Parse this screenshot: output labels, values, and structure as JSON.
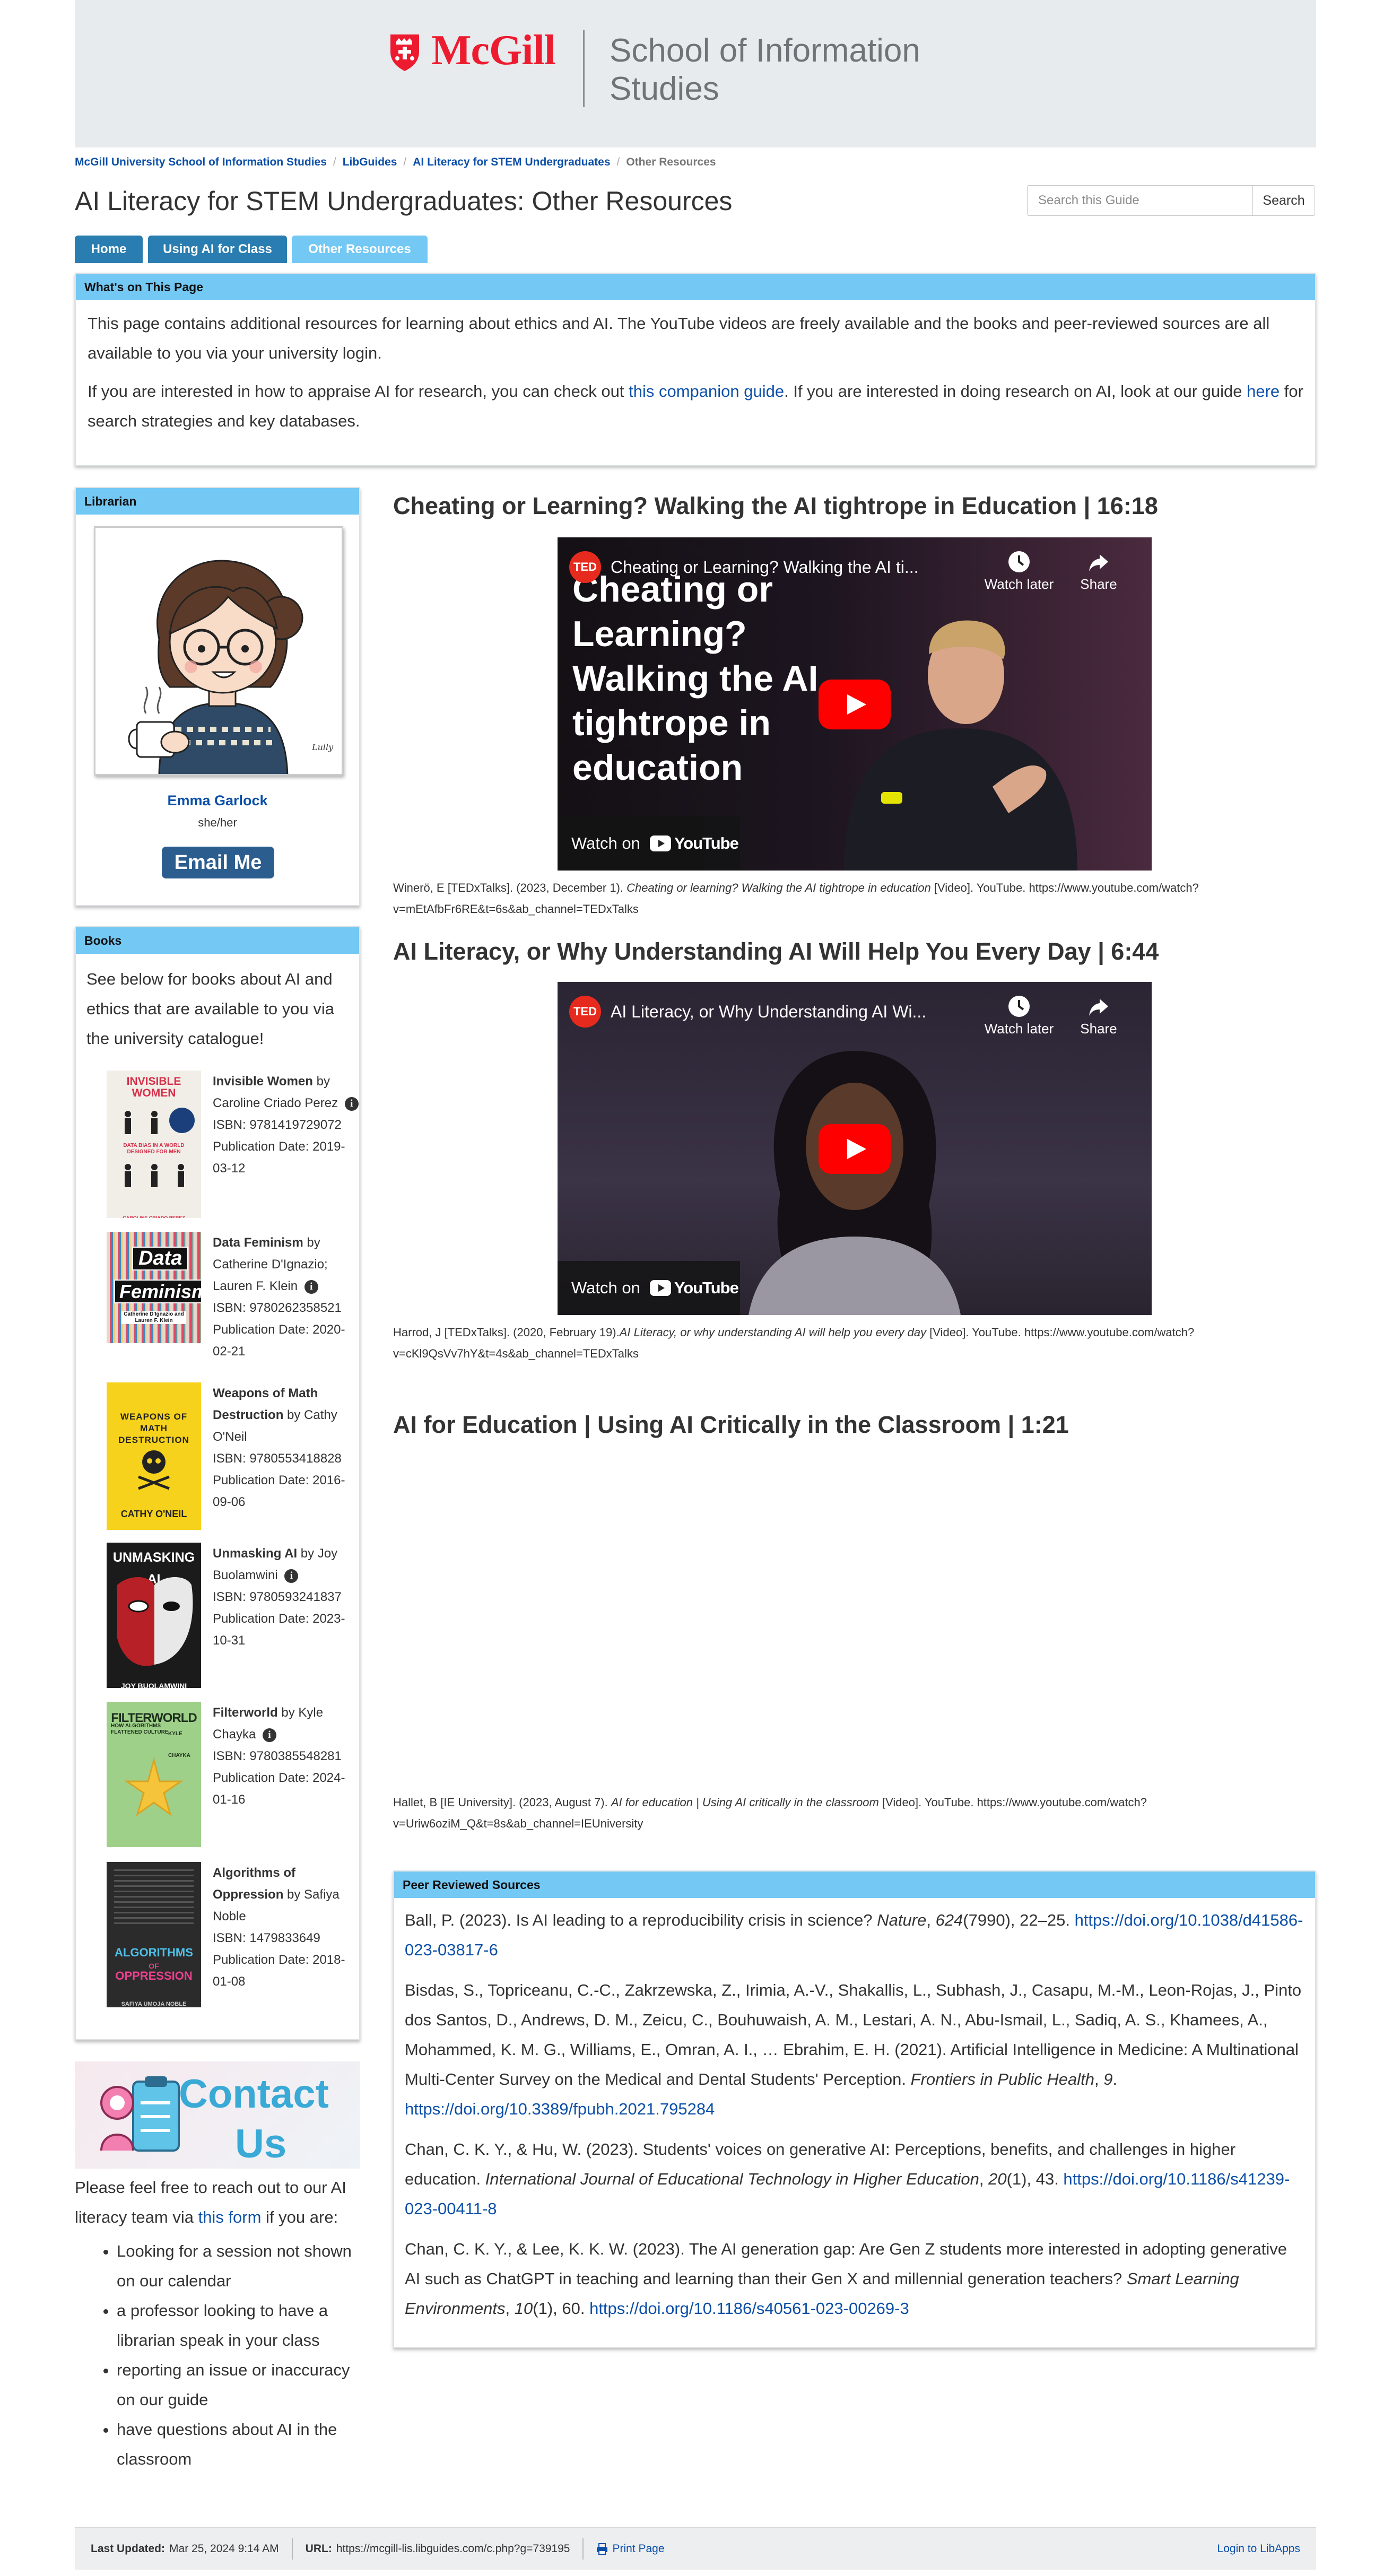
{
  "header": {
    "logo_text": "McGill",
    "school_name": "School of Information Studies"
  },
  "breadcrumb": [
    "McGill University School of Information Studies",
    "LibGuides",
    "AI Literacy for STEM Undergraduates",
    "Other Resources"
  ],
  "page_title": "AI Literacy for STEM Undergraduates: Other Resources",
  "search": {
    "placeholder": "Search this Guide",
    "button_label": "Search"
  },
  "tabs": [
    {
      "label": "Home"
    },
    {
      "label": "Using AI for Class"
    },
    {
      "label": "Other Resources"
    }
  ],
  "whats_on": {
    "heading": "What's on This Page",
    "para1": "This page contains additional resources for learning about ethics and AI. The YouTube videos are freely available and the books and peer-reviewed sources are all available to you via your university login.",
    "para2_before": "If you are interested in how to appraise AI for research, you can check out ",
    "para2_link1": "this companion guide",
    "para2_middle": ". If you are interested in doing research on AI, look at our guide ",
    "para2_link2": "here",
    "para2_after": " for search strategies and key databases."
  },
  "librarian": {
    "heading": "Librarian",
    "name": "Emma Garlock",
    "pronouns": "she/her",
    "email_button": "Email Me",
    "signature": "Lully"
  },
  "books": {
    "heading": "Books",
    "intro": "See below for books about AI and ethics that are available to you via the university catalogue!",
    "items": [
      {
        "title": "Invisible Women",
        "by": " by ",
        "author": "Caroline Criado Perez",
        "isbn": "ISBN: 9781419729072",
        "pubdate": "Publication Date: 2019-03-12",
        "cover_title": "INVISIBLE WOMEN",
        "cover_sub": "DATA BIAS IN A WORLD DESIGNED FOR MEN",
        "cover_author": "CAROLINE CRIADO PEREZ"
      },
      {
        "title": "Data Feminism",
        "by": " by ",
        "author": "Catherine D'Ignazio; Lauren F. Klein",
        "isbn": "ISBN: 9780262358521",
        "pubdate": "Publication Date: 2020-02-21",
        "cover_title_1": "Data",
        "cover_title_2": "Feminism",
        "cover_author": "Catherine D'Ignazio and Lauren F. Klein"
      },
      {
        "title": "Weapons of Math Destruction",
        "by": " by ",
        "author": "Cathy O'Neil",
        "isbn": "ISBN: 9780553418828",
        "pubdate": "Publication Date: 2016-09-06",
        "cover_title": "WEAPONS OF MATH DESTRUCTION",
        "cover_author": "CATHY O'NEIL"
      },
      {
        "title": "Unmasking AI",
        "by": " by ",
        "author": "Joy Buolamwini",
        "isbn": "ISBN: 9780593241837",
        "pubdate": "Publication Date: 2023-10-31",
        "cover_title": "UNMASKING AI",
        "cover_author": "JOY BUOLAMWINI"
      },
      {
        "title": "Filterworld",
        "by": " by ",
        "author": "Kyle Chayka",
        "isbn": "ISBN: 9780385548281",
        "pubdate": "Publication Date: 2024-01-16",
        "cover_title": "FILTERWORLD",
        "cover_sub": "HOW ALGORITHMS FLATTENED CULTURE",
        "cover_author": "KYLE CHAYKA"
      },
      {
        "title": "Algorithms of Oppression",
        "by": " by ",
        "author": "Safiya Noble",
        "isbn": "ISBN: 1479833649",
        "pubdate": "Publication Date: 2018-01-08",
        "cover_title_1": "ALGORITHMS",
        "cover_title_2": "OPPRESSION",
        "cover_of": "OF",
        "cover_author": "SAFIYA UMOJA NOBLE"
      }
    ]
  },
  "contact": {
    "banner_text_1": "Contact",
    "banner_text_2": "Us",
    "intro_before": "Please feel free to reach out to our AI literacy team via ",
    "intro_link": "this form",
    "intro_after": " if you are:",
    "items": [
      "Looking for a session not shown on our calendar",
      "a professor looking to have a librarian speak in your class",
      "reporting an issue or inaccuracy on our guide",
      "have questions about AI in the classroom"
    ]
  },
  "videos": [
    {
      "title": "Cheating or Learning? Walking the AI tightrope in Education | 16:18",
      "player_title": "Cheating or Learning? Walking the AI ti...",
      "overlay": "Cheating or Learning? Walking the AI tightrope in education",
      "watch_later": "Watch later",
      "share": "Share",
      "watch_on": "Watch on",
      "youtube": "YouTube",
      "channel_badge": "TED",
      "cite_before": "Winerö, E [TEDxTalks]. (2023, December 1). ",
      "cite_italic": "Cheating or learning? Walking the AI tightrope in education",
      "cite_after": " [Video]. YouTube. https://www.youtube.com/watch?v=mEtAfbFr6RE&t=6s&ab_channel=TEDxTalks"
    },
    {
      "title": "AI Literacy, or Why Understanding AI Will Help You Every Day | 6:44",
      "player_title": "AI Literacy, or Why Understanding AI Wi...",
      "watch_later": "Watch later",
      "share": "Share",
      "watch_on": "Watch on",
      "youtube": "YouTube",
      "channel_badge": "TED",
      "cite_before": "Harrod, J [TEDxTalks]. (2020, February 19).",
      "cite_italic": "AI Literacy, or why understanding AI will help you every day ",
      "cite_after": " [Video]. YouTube. https://www.youtube.com/watch?v=cKl9QsVv7hY&t=4s&ab_channel=TEDxTalks"
    },
    {
      "title": "AI for Education | Using AI Critically in the Classroom | 1:21",
      "cite_before": "Hallet, B [IE University]. (2023, August 7). ",
      "cite_italic": "AI for education | Using AI critically in the classroom",
      "cite_after": " [Video]. YouTube. https://www.youtube.com/watch?v=Uriw6oziM_Q&t=8s&ab_channel=IEUniversity"
    }
  ],
  "peer": {
    "heading": "Peer Reviewed Sources",
    "refs": [
      {
        "before": "Ball, P. (2023). Is AI leading to a reproducibility crisis in science? ",
        "italic": "Nature",
        "middle": ", ",
        "italic2": "624",
        "after": "(7990), 22–25. ",
        "link": "https://doi.org/10.1038/d41586-023-03817-6"
      },
      {
        "before": "Bisdas, S., Topriceanu, C.-C., Zakrzewska, Z., Irimia, A.-V., Shakallis, L., Subhash, J., Casapu, M.-M., Leon-Rojas, J., Pinto dos Santos, D., Andrews, D. M., Zeicu, C., Bouhuwaish, A. M., Lestari, A. N., Abu-Ismail, L., Sadiq, A. S., Khamees, A., Mohammed, K. M. G., Williams, E., Omran, A. I., … Ebrahim, E. H. (2021). Artificial Intelligence in Medicine: A Multinational Multi-Center Survey on the Medical and Dental Students' Perception. ",
        "italic": "Frontiers in Public Health",
        "middle": ", ",
        "italic2": "9",
        "after": ". ",
        "link": "https://doi.org/10.3389/fpubh.2021.795284"
      },
      {
        "before": "Chan, C. K. Y., & Hu, W. (2023). Students' voices on generative AI: Perceptions, benefits, and challenges in higher education. ",
        "italic": "International Journal of Educational Technology in Higher Education",
        "middle": ", ",
        "italic2": "20",
        "after": "(1), 43. ",
        "link": "https://doi.org/10.1186/s41239-023-00411-8"
      },
      {
        "before": "Chan, C. K. Y., & Lee, K. K. W. (2023). The AI generation gap: Are Gen Z students more interested in adopting generative AI such as ChatGPT in teaching and learning than their Gen X and millennial generation teachers? ",
        "italic": "Smart Learning Environments",
        "middle": ", ",
        "italic2": "10",
        "after": "(1), 60. ",
        "link": "https://doi.org/10.1186/s40561-023-00269-3"
      }
    ]
  },
  "footer": {
    "updated_label": "Last Updated:",
    "updated_value": "Mar 25, 2024 9:14 AM",
    "url_label": "URL:",
    "url_value": "https://mcgill-lis.libguides.com/c.php?g=739195",
    "print_label": "Print Page",
    "login_label": "Login to LibApps"
  },
  "colors": {
    "mcgill_red": "#ed1b2f",
    "tab_dark": "#2a7db0",
    "tab_active": "#73c8f4",
    "panel_head": "#73c8f4",
    "link": "#0b4fa8",
    "email_button": "#2c5d8f",
    "youtube_red": "#ff0000"
  }
}
